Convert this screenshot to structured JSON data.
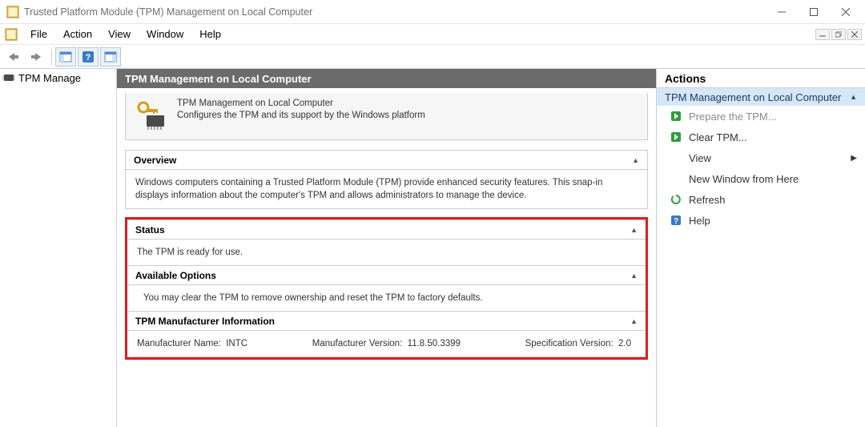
{
  "window": {
    "title": "Trusted Platform Module (TPM) Management on Local Computer"
  },
  "menu": {
    "file": "File",
    "action": "Action",
    "view": "View",
    "window": "Window",
    "help": "Help"
  },
  "tree": {
    "root": "TPM Manage"
  },
  "center": {
    "header": "TPM Management on Local Computer",
    "intro_title": "TPM Management on Local Computer",
    "intro_desc": "Configures the TPM and its support by the Windows platform",
    "overview_title": "Overview",
    "overview_text": "Windows computers containing a Trusted Platform Module (TPM) provide enhanced security features. This snap-in displays information about the computer's TPM and allows administrators to manage the device.",
    "status_title": "Status",
    "status_text": "The TPM is ready for use.",
    "options_title": "Available Options",
    "options_text": "You may clear the TPM to remove ownership and reset the TPM to factory defaults.",
    "mfr_title": "TPM Manufacturer Information",
    "mfr_name_label": "Manufacturer Name:",
    "mfr_name_value": "INTC",
    "mfr_version_label": "Manufacturer Version:",
    "mfr_version_value": "11.8.50.3399",
    "spec_version_label": "Specification Version:",
    "spec_version_value": "2.0"
  },
  "actions": {
    "header": "Actions",
    "group": "TPM Management on Local Computer",
    "prepare": "Prepare the TPM...",
    "clear": "Clear TPM...",
    "view": "View",
    "new_window": "New Window from Here",
    "refresh": "Refresh",
    "help": "Help"
  }
}
